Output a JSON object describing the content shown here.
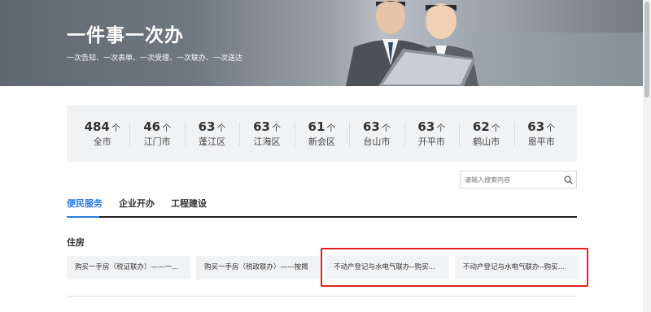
{
  "banner": {
    "title": "一件事一次办",
    "subtitle": "一次告知、一次表单、一次受理、一次联办、一次送达"
  },
  "stats": [
    {
      "count": "484",
      "unit": "个",
      "label": "全市"
    },
    {
      "count": "46",
      "unit": "个",
      "label": "江门市"
    },
    {
      "count": "63",
      "unit": "个",
      "label": "蓬江区"
    },
    {
      "count": "63",
      "unit": "个",
      "label": "江海区"
    },
    {
      "count": "61",
      "unit": "个",
      "label": "新会区"
    },
    {
      "count": "63",
      "unit": "个",
      "label": "台山市"
    },
    {
      "count": "63",
      "unit": "个",
      "label": "开平市"
    },
    {
      "count": "62",
      "unit": "个",
      "label": "鹤山市"
    },
    {
      "count": "63",
      "unit": "个",
      "label": "恩平市"
    }
  ],
  "search": {
    "placeholder": "请输入搜索内容",
    "value": ""
  },
  "tabs": [
    {
      "label": "便民服务",
      "active": true
    },
    {
      "label": "企业开办",
      "active": false
    },
    {
      "label": "工程建设",
      "active": false
    }
  ],
  "section": {
    "title": "住房",
    "items": [
      {
        "label": "购买一手房（税证联办）——一..."
      },
      {
        "label": "购买一手房（税政联办）——按揭"
      },
      {
        "label": "不动产登记与水电气联办--购买..."
      },
      {
        "label": "不动产登记与水电气联办--购买..."
      }
    ]
  },
  "colors": {
    "accent": "#2d7be0",
    "highlight": "#e0201f",
    "card_bg": "#f1f2f4"
  }
}
